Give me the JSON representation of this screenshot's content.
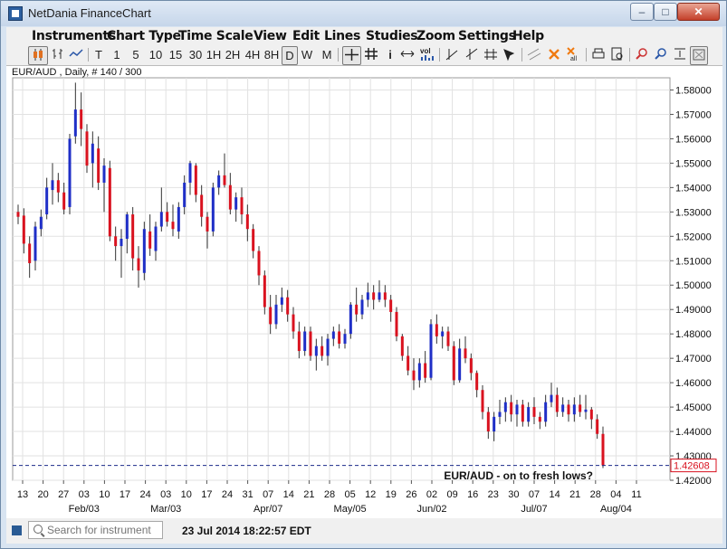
{
  "window": {
    "title": "NetDania FinanceChart"
  },
  "menu": [
    "Instruments",
    "Chart Type",
    "Time Scale",
    "View",
    "Edit",
    "Lines",
    "Studies",
    "Zoom",
    "Settings",
    "Help"
  ],
  "toolbar": {
    "periods": [
      "T",
      "1",
      "5",
      "10",
      "15",
      "30",
      "1H",
      "2H",
      "4H",
      "8H",
      "D",
      "W",
      "M"
    ],
    "selected_period": "D"
  },
  "symbol_label": "EUR/AUD , Daily, # 140 / 300",
  "annotation": "EUR/AUD - on to fresh lows?",
  "last_price": "1.42608",
  "search": {
    "placeholder": "Search for instrument"
  },
  "status": {
    "datetime": "23 Jul 2014 18:22:57 EDT"
  },
  "colors": {
    "up": "#1f2fc7",
    "down": "#d9121f"
  },
  "chart_data": {
    "type": "candlestick",
    "ylim": [
      1.42,
      1.585
    ],
    "y_ticks": [
      "1.58000",
      "1.57000",
      "1.56000",
      "1.55000",
      "1.54000",
      "1.53000",
      "1.52000",
      "1.51000",
      "1.50000",
      "1.49000",
      "1.48000",
      "1.47000",
      "1.46000",
      "1.45000",
      "1.44000",
      "1.43000",
      "1.42000"
    ],
    "x_day_labels": [
      "13",
      "20",
      "27",
      "03",
      "10",
      "17",
      "24",
      "03",
      "10",
      "17",
      "24",
      "31",
      "07",
      "14",
      "21",
      "28",
      "05",
      "12",
      "19",
      "26",
      "02",
      "09",
      "16",
      "23",
      "30",
      "07",
      "14",
      "21",
      "28",
      "04",
      "11"
    ],
    "x_month_labels": [
      "Feb/03",
      "Mar/03",
      "Apr/07",
      "May/05",
      "Jun/02",
      "Jul/07",
      "Aug/04"
    ],
    "candles": [
      [
        1.53,
        1.533,
        1.525,
        1.528
      ],
      [
        1.5285,
        1.5315,
        1.513,
        1.517
      ],
      [
        1.517,
        1.52,
        1.503,
        1.509
      ],
      [
        1.51,
        1.526,
        1.506,
        1.524
      ],
      [
        1.523,
        1.531,
        1.52,
        1.528
      ],
      [
        1.529,
        1.544,
        1.527,
        1.54
      ],
      [
        1.539,
        1.55,
        1.533,
        1.543
      ],
      [
        1.543,
        1.546,
        1.534,
        1.538
      ],
      [
        1.538,
        1.542,
        1.529,
        1.531
      ],
      [
        1.532,
        1.562,
        1.529,
        1.56
      ],
      [
        1.561,
        1.583,
        1.558,
        1.572
      ],
      [
        1.572,
        1.579,
        1.557,
        1.564
      ],
      [
        1.563,
        1.566,
        1.546,
        1.549
      ],
      [
        1.55,
        1.563,
        1.54,
        1.558
      ],
      [
        1.556,
        1.561,
        1.539,
        1.542
      ],
      [
        1.542,
        1.552,
        1.53,
        1.549
      ],
      [
        1.548,
        1.551,
        1.518,
        1.52
      ],
      [
        1.52,
        1.524,
        1.51,
        1.516
      ],
      [
        1.516,
        1.523,
        1.503,
        1.519
      ],
      [
        1.519,
        1.53,
        1.513,
        1.529
      ],
      [
        1.529,
        1.532,
        1.506,
        1.511
      ],
      [
        1.511,
        1.516,
        1.499,
        1.506
      ],
      [
        1.505,
        1.526,
        1.502,
        1.523
      ],
      [
        1.522,
        1.529,
        1.512,
        1.515
      ],
      [
        1.514,
        1.526,
        1.51,
        1.524
      ],
      [
        1.524,
        1.54,
        1.522,
        1.53
      ],
      [
        1.53,
        1.534,
        1.524,
        1.526
      ],
      [
        1.526,
        1.533,
        1.52,
        1.523
      ],
      [
        1.522,
        1.534,
        1.519,
        1.532
      ],
      [
        1.532,
        1.545,
        1.529,
        1.542
      ],
      [
        1.542,
        1.551,
        1.537,
        1.55
      ],
      [
        1.549,
        1.55,
        1.534,
        1.537
      ],
      [
        1.537,
        1.541,
        1.524,
        1.528
      ],
      [
        1.528,
        1.53,
        1.515,
        1.522
      ],
      [
        1.522,
        1.542,
        1.52,
        1.54
      ],
      [
        1.54,
        1.547,
        1.537,
        1.545
      ],
      [
        1.545,
        1.554,
        1.54,
        1.541
      ],
      [
        1.541,
        1.546,
        1.529,
        1.531
      ],
      [
        1.531,
        1.538,
        1.526,
        1.536
      ],
      [
        1.536,
        1.54,
        1.525,
        1.529
      ],
      [
        1.529,
        1.533,
        1.518,
        1.523
      ],
      [
        1.523,
        1.525,
        1.511,
        1.514
      ],
      [
        1.514,
        1.516,
        1.5,
        1.504
      ],
      [
        1.504,
        1.506,
        1.488,
        1.491
      ],
      [
        1.491,
        1.496,
        1.48,
        1.484
      ],
      [
        1.484,
        1.496,
        1.482,
        1.492
      ],
      [
        1.492,
        1.499,
        1.489,
        1.495
      ],
      [
        1.495,
        1.498,
        1.485,
        1.488
      ],
      [
        1.488,
        1.491,
        1.478,
        1.481
      ],
      [
        1.481,
        1.485,
        1.47,
        1.473
      ],
      [
        1.473,
        1.483,
        1.471,
        1.481
      ],
      [
        1.481,
        1.483,
        1.469,
        1.471
      ],
      [
        1.471,
        1.478,
        1.465,
        1.475
      ],
      [
        1.475,
        1.479,
        1.469,
        1.471
      ],
      [
        1.471,
        1.48,
        1.467,
        1.478
      ],
      [
        1.478,
        1.483,
        1.475,
        1.481
      ],
      [
        1.481,
        1.484,
        1.474,
        1.476
      ],
      [
        1.476,
        1.482,
        1.474,
        1.48
      ],
      [
        1.48,
        1.493,
        1.478,
        1.492
      ],
      [
        1.492,
        1.499,
        1.485,
        1.488
      ],
      [
        1.488,
        1.496,
        1.486,
        1.494
      ],
      [
        1.494,
        1.501,
        1.491,
        1.497
      ],
      [
        1.497,
        1.5,
        1.49,
        1.494
      ],
      [
        1.494,
        1.502,
        1.493,
        1.497
      ],
      [
        1.497,
        1.5,
        1.491,
        1.494
      ],
      [
        1.494,
        1.496,
        1.485,
        1.489
      ],
      [
        1.489,
        1.491,
        1.477,
        1.479
      ],
      [
        1.479,
        1.48,
        1.469,
        1.471
      ],
      [
        1.471,
        1.475,
        1.463,
        1.465
      ],
      [
        1.465,
        1.47,
        1.457,
        1.461
      ],
      [
        1.461,
        1.47,
        1.458,
        1.468
      ],
      [
        1.468,
        1.473,
        1.46,
        1.462
      ],
      [
        1.462,
        1.486,
        1.461,
        1.484
      ],
      [
        1.484,
        1.488,
        1.476,
        1.479
      ],
      [
        1.479,
        1.483,
        1.474,
        1.481
      ],
      [
        1.481,
        1.483,
        1.473,
        1.475
      ],
      [
        1.475,
        1.477,
        1.459,
        1.461
      ],
      [
        1.461,
        1.478,
        1.46,
        1.474
      ],
      [
        1.474,
        1.479,
        1.468,
        1.47
      ],
      [
        1.47,
        1.472,
        1.461,
        1.464
      ],
      [
        1.464,
        1.465,
        1.454,
        1.457
      ],
      [
        1.457,
        1.459,
        1.445,
        1.448
      ],
      [
        1.448,
        1.45,
        1.437,
        1.44
      ],
      [
        1.44,
        1.448,
        1.436,
        1.446
      ],
      [
        1.446,
        1.453,
        1.443,
        1.448
      ],
      [
        1.448,
        1.454,
        1.444,
        1.452
      ],
      [
        1.452,
        1.455,
        1.444,
        1.447
      ],
      [
        1.447,
        1.453,
        1.442,
        1.451
      ],
      [
        1.451,
        1.453,
        1.442,
        1.444
      ],
      [
        1.444,
        1.452,
        1.442,
        1.45
      ],
      [
        1.45,
        1.454,
        1.443,
        1.446
      ],
      [
        1.446,
        1.448,
        1.441,
        1.444
      ],
      [
        1.444,
        1.455,
        1.442,
        1.452
      ],
      [
        1.452,
        1.46,
        1.45,
        1.455
      ],
      [
        1.455,
        1.458,
        1.446,
        1.448
      ],
      [
        1.448,
        1.454,
        1.446,
        1.451
      ],
      [
        1.451,
        1.453,
        1.444,
        1.447
      ],
      [
        1.447,
        1.454,
        1.444,
        1.451
      ],
      [
        1.451,
        1.455,
        1.446,
        1.448
      ],
      [
        1.448,
        1.455,
        1.445,
        1.449
      ],
      [
        1.449,
        1.45,
        1.441,
        1.445
      ],
      [
        1.445,
        1.447,
        1.437,
        1.439
      ],
      [
        1.439,
        1.442,
        1.425,
        1.4261
      ]
    ]
  }
}
